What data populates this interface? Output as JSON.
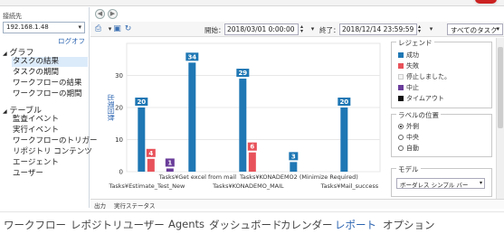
{
  "sidebar": {
    "connection_label": "接続先",
    "connection_value": "192.168.1.48",
    "logout": "ログオフ",
    "groups": [
      {
        "label": "グラフ",
        "items": [
          "タスクの結果",
          "タスクの期間",
          "ワークフローの結果",
          "ワークフローの期間"
        ]
      },
      {
        "label": "テーブル",
        "items": [
          "監査イベント",
          "実行イベント",
          "ワークフローのトリガー",
          "リポジトリ コンテンツ",
          "エージェント",
          "ユーザー"
        ]
      }
    ],
    "selected_item": "タスクの結果"
  },
  "toolbar": {
    "start_label": "開始：",
    "start_value": "2018/03/01 0:00:00",
    "end_label": "終了：",
    "end_value": "2018/12/14 23:59:59",
    "task_filter": "すべてのタスク"
  },
  "chart_data": {
    "type": "bar",
    "ylabel": "出現回数",
    "ylim": [
      0,
      40
    ],
    "yticks": [
      0,
      10,
      20,
      30
    ],
    "categories": [
      "Tasks¥Estimate_Test_New",
      "Tasks¥Get excel from mail",
      "Tasks¥KONADEMO_MAIL",
      "Tasks¥KONADEMO2 (Minimize Required)",
      "Tasks¥Mail_success"
    ],
    "series": [
      {
        "name": "成功",
        "color": "#1f77b4",
        "values": [
          20,
          34,
          29,
          3,
          20
        ]
      },
      {
        "name": "失敗",
        "color": "#e8525a",
        "values": [
          4,
          0,
          6,
          0,
          0
        ]
      },
      {
        "name": "停止しました",
        "color": "#f0f0f0",
        "values": [
          0,
          0,
          0,
          0,
          0
        ]
      },
      {
        "name": "中止",
        "color": "#6a3d9a",
        "values": [
          1,
          0,
          0,
          0,
          0
        ]
      },
      {
        "name": "タイムアウト",
        "color": "#111111",
        "values": [
          0,
          0,
          0,
          0,
          0
        ]
      }
    ],
    "data_labels": [
      {
        "series": "成功",
        "category": "Tasks¥Estimate_Test_New",
        "value": "20"
      },
      {
        "series": "失敗",
        "category": "Tasks¥Estimate_Test_New",
        "value": "4"
      },
      {
        "series": "中止",
        "category": "Tasks¥Estimate_Test_New",
        "value": "1"
      },
      {
        "series": "成功",
        "category": "Tasks¥Get excel from mail",
        "value": "34"
      },
      {
        "series": "成功",
        "category": "Tasks¥KONADEMO_MAIL",
        "value": "29"
      },
      {
        "series": "失敗",
        "category": "Tasks¥KONADEMO_MAIL",
        "value": "6"
      },
      {
        "series": "成功",
        "category": "Tasks¥KONADEMO2 (Minimize Required)",
        "value": "3"
      },
      {
        "series": "成功",
        "category": "Tasks¥Mail_success",
        "value": "20"
      }
    ],
    "grid": true
  },
  "legend": {
    "title": "レジェンド",
    "items": [
      {
        "label": "成功",
        "color": "#1f77b4"
      },
      {
        "label": "失敗",
        "color": "#e8525a"
      },
      {
        "label": "停止しました。",
        "color": "#f4f4f4"
      },
      {
        "label": "中止",
        "color": "#6a3d9a"
      },
      {
        "label": "タイムアウト",
        "color": "#111111"
      }
    ]
  },
  "label_position": {
    "title": "ラベルの位置",
    "options": [
      "外側",
      "中央",
      "自動"
    ],
    "selected": "外側"
  },
  "model": {
    "title": "モデル",
    "value": "ボーダレス シンプル バー"
  },
  "output": {
    "tabs": [
      "出力",
      "実行ステータス"
    ]
  },
  "mainnav": {
    "items": [
      "ワークフロー",
      "レポジトリ",
      "ユーザー",
      "Agents",
      "ダッシュボード",
      "カレンダー",
      "レポート",
      "オプション"
    ],
    "active": "レポート"
  }
}
